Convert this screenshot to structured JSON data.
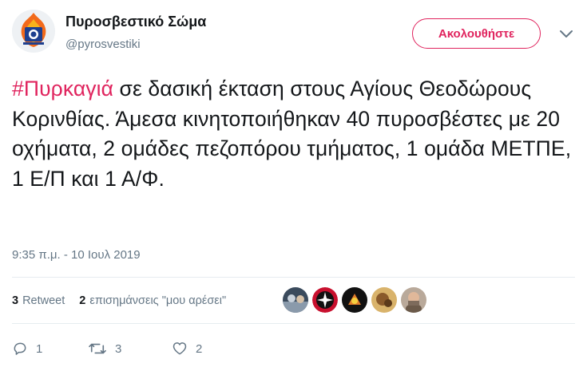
{
  "account": {
    "name": "Πυροσβεστικό Σώμα",
    "handle": "@pyrosvestiki",
    "avatar_icon": "fire-service-emblem-icon"
  },
  "follow_button_label": "Ακολουθήστε",
  "tweet": {
    "hashtag": "#Πυρκαγιά",
    "text": " σε δασική έκταση στους Αγίους Θεοδώρους Κορινθίας. Άμεσα κινητοποιήθηκαν 40 πυροσβέστες με 20 οχήματα, 2 ομάδες πεζοπόρου τμήματος, 1 ομάδα ΜΕΤΠΕ, 1 Ε/Π και 1 Α/Φ.",
    "timestamp": "9:35 π.μ. - 10 Ιουλ 2019"
  },
  "stats": {
    "retweets_count": "3",
    "retweets_label": "Retweet",
    "likes_count": "2",
    "likes_label": "επισημάνσεις \"μου αρέσει\""
  },
  "actions": {
    "reply_count": "1",
    "retweet_count": "3",
    "like_count": "2"
  },
  "colors": {
    "accent": "#e0245e",
    "text": "#14171a",
    "secondary_text": "#657786",
    "divider": "#e6ecf0"
  }
}
